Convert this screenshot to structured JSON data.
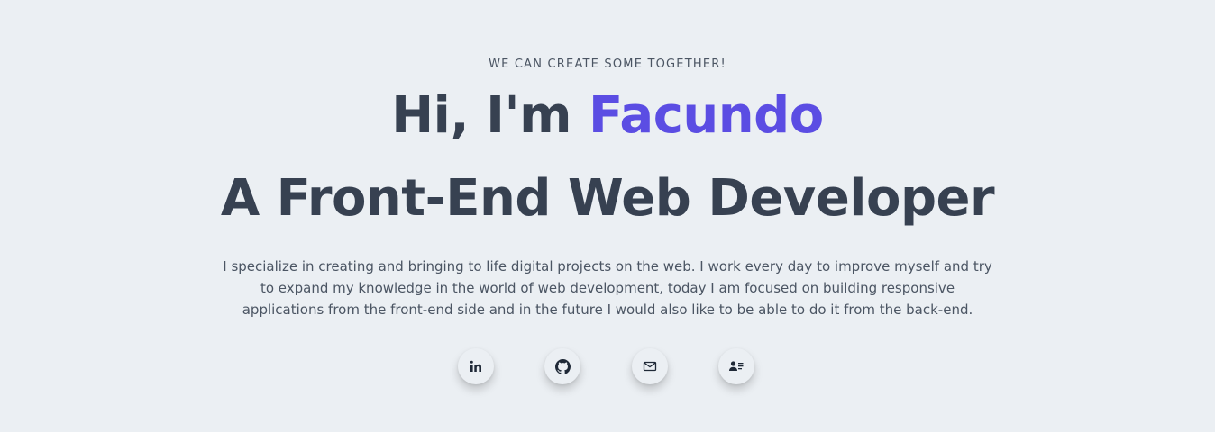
{
  "hero": {
    "eyebrow": "WE CAN CREATE SOME TOGETHER!",
    "greeting_prefix": "Hi, I'm ",
    "name": "Facundo",
    "role": "A Front-End Web Developer",
    "bio": "I specialize in creating and bringing to life digital projects on the web. I work every day to improve myself and try to expand my knowledge in the world of web development, today I am focused on building responsive applications from the front-end side and in the future I would also like to be able to do it from the back-end."
  },
  "socials": [
    {
      "icon": "linkedin-icon"
    },
    {
      "icon": "github-icon"
    },
    {
      "icon": "mail-icon"
    },
    {
      "icon": "contact-card-icon"
    }
  ],
  "colors": {
    "background": "#ebeff3",
    "text": "#374151",
    "accent": "#5b4de3"
  }
}
